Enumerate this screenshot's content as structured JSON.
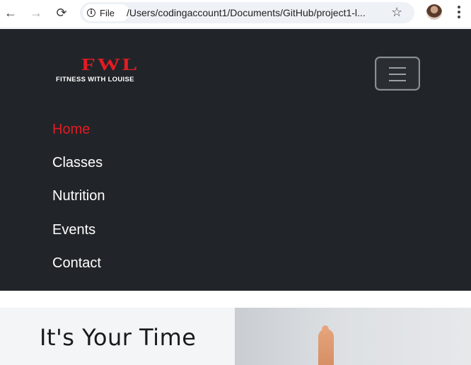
{
  "browser": {
    "chip_label": "File",
    "url": "/Users/codingaccount1/Documents/GitHub/project1-l..."
  },
  "site": {
    "logo_main": "FWL",
    "logo_sub": "FITNESS WITH LOUISE",
    "nav_links": [
      "Home",
      "Classes",
      "Nutrition",
      "Events",
      "Contact"
    ],
    "active_link": "Home"
  },
  "hero": {
    "title": "It's Your Time",
    "subtitle": "..."
  },
  "colors": {
    "brand_red": "#e31b23",
    "nav_background": "#212529"
  }
}
